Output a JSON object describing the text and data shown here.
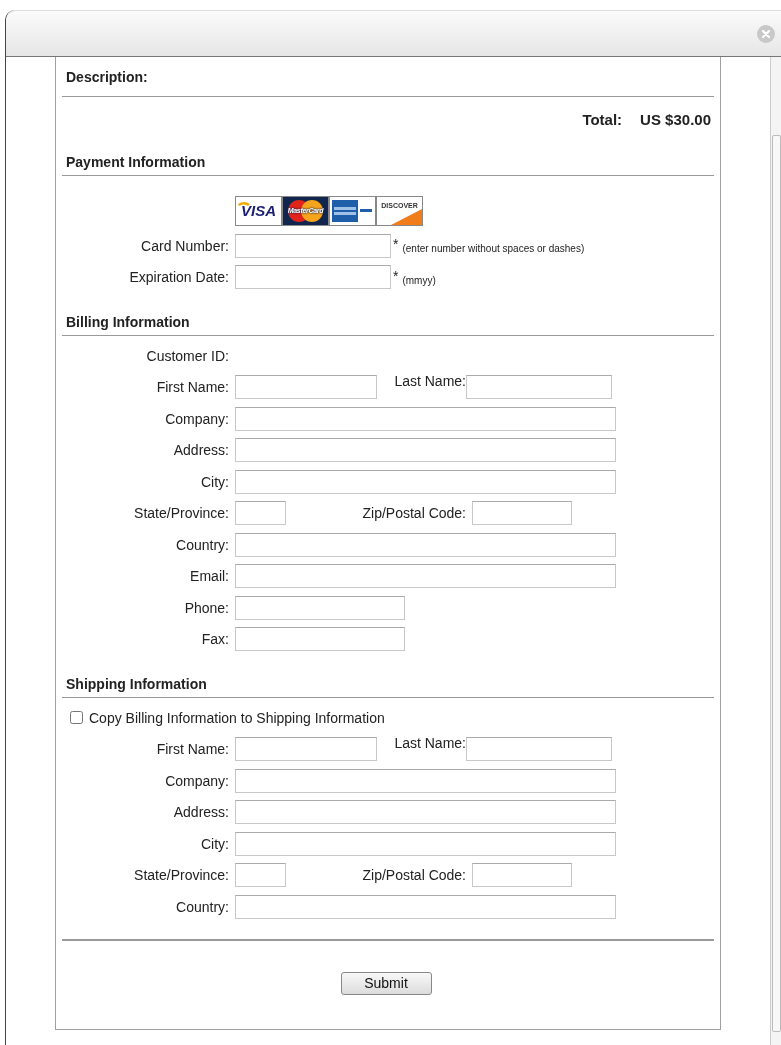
{
  "description_label": "Description:",
  "total": {
    "label": "Total:",
    "value": "US $30.00"
  },
  "sections": [
    {
      "title": "Payment Information",
      "card_logos": [
        {
          "kind": "visa",
          "label": "VISA"
        },
        {
          "kind": "mastercard",
          "label": "MasterCard"
        },
        {
          "kind": "amex"
        },
        {
          "kind": "discover",
          "label": "DISCOVER"
        }
      ],
      "rows": [
        {
          "kind": "card",
          "label": "Card Number:",
          "mark": "*",
          "hint": "(enter number without spaces or dashes)"
        },
        {
          "kind": "card",
          "label": "Expiration Date:",
          "mark": "*",
          "hint": "(mmyy)"
        }
      ]
    },
    {
      "title": "Billing Information",
      "rows": [
        {
          "kind": "text",
          "label": "Customer ID:"
        },
        {
          "kind": "names",
          "label": "First Name:",
          "label2": "Last Name:"
        },
        {
          "kind": "wide",
          "label": "Company:"
        },
        {
          "kind": "wide",
          "label": "Address:"
        },
        {
          "kind": "wide",
          "label": "City:"
        },
        {
          "kind": "place",
          "label": "State/Province:",
          "label2": "Zip/Postal Code:"
        },
        {
          "kind": "wide",
          "label": "Country:"
        },
        {
          "kind": "wide",
          "label": "Email:"
        },
        {
          "kind": "short",
          "label": "Phone:"
        },
        {
          "kind": "short",
          "label": "Fax:"
        }
      ]
    },
    {
      "title": "Shipping Information",
      "rows": [
        {
          "kind": "checkbox",
          "label": "Copy Billing Information to Shipping Information",
          "checked": false
        },
        {
          "kind": "names",
          "label": "First Name:",
          "label2": "Last Name:"
        },
        {
          "kind": "wide",
          "label": "Company:"
        },
        {
          "kind": "wide",
          "label": "Address:"
        },
        {
          "kind": "wide",
          "label": "City:"
        },
        {
          "kind": "place",
          "label": "State/Province:",
          "label2": "Zip/Postal Code:"
        },
        {
          "kind": "wide",
          "label": "Country:"
        }
      ]
    }
  ],
  "submit": "Submit"
}
